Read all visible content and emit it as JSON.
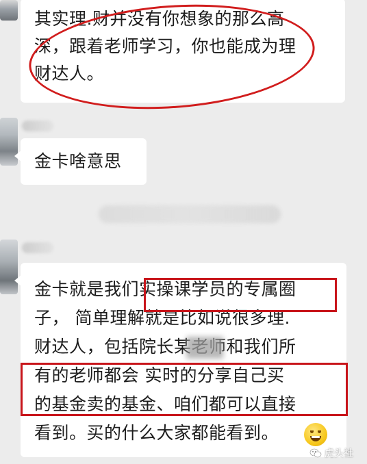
{
  "messages": [
    {
      "lines": [
        "其实理.财并没有你想象的那么高",
        "深，跟着老师学习，你也能成为理",
        "财达人。"
      ]
    },
    {
      "lines": [
        "金卡啥意思"
      ]
    },
    {
      "lines": [
        "金卡就是我们实操课学员的专属圈",
        "子，  简单理解就是比如说很多理.",
        "财达人，包括院长某老师和我们所",
        "有的老师都会 实时的分享自己买",
        "的基金卖的基金、咱们都可以直接",
        "看到。买的什么大家都能看到。"
      ]
    }
  ],
  "watermark": {
    "label": "虎头社",
    "icon": "wechat-icon"
  },
  "colors": {
    "background": "#ececec",
    "bubble": "#ffffff",
    "annotation_red": "#c8151b"
  }
}
